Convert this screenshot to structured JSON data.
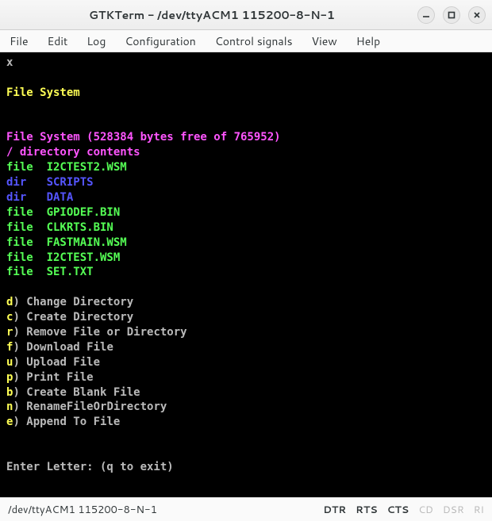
{
  "titlebar": {
    "title": "GTKTerm - /dev/ttyACM1 115200-8-N-1"
  },
  "menubar": {
    "items": [
      "File",
      "Edit",
      "Log",
      "Configuration",
      "Control signals",
      "View",
      "Help"
    ]
  },
  "term": {
    "top_line": "x",
    "header": "File System",
    "fs_line": {
      "prefix": "File System (",
      "bytes_free": "528384",
      "mid": " bytes free of ",
      "total": "765952",
      "suffix": ")"
    },
    "dir_header": "/ directory contents",
    "listing": [
      {
        "kind": "file",
        "name": "I2CTEST2.WSM"
      },
      {
        "kind": "dir",
        "name": "SCRIPTS"
      },
      {
        "kind": "dir",
        "name": "DATA"
      },
      {
        "kind": "file",
        "name": "GPIODEF.BIN"
      },
      {
        "kind": "file",
        "name": "CLKRTS.BIN"
      },
      {
        "kind": "file",
        "name": "FASTMAIN.WSM"
      },
      {
        "kind": "file",
        "name": "I2CTEST.WSM"
      },
      {
        "kind": "file",
        "name": "SET.TXT"
      }
    ],
    "menu": [
      {
        "key": "d",
        "label": "Change Directory"
      },
      {
        "key": "c",
        "label": "Create Directory"
      },
      {
        "key": "r",
        "label": "Remove File or Directory"
      },
      {
        "key": "f",
        "label": "Download File"
      },
      {
        "key": "u",
        "label": "Upload File"
      },
      {
        "key": "p",
        "label": "Print File"
      },
      {
        "key": "b",
        "label": "Create Blank File"
      },
      {
        "key": "n",
        "label": "RenameFileOrDirectory"
      },
      {
        "key": "e",
        "label": "Append To File"
      }
    ],
    "prompt": "Enter Letter: (q to exit)"
  },
  "statusbar": {
    "left": "/dev/ttyACM1 115200-8-N-1",
    "signals": [
      {
        "name": "DTR",
        "on": true
      },
      {
        "name": "RTS",
        "on": true
      },
      {
        "name": "CTS",
        "on": true
      },
      {
        "name": "CD",
        "on": false
      },
      {
        "name": "DSR",
        "on": false
      },
      {
        "name": "RI",
        "on": false
      }
    ]
  }
}
